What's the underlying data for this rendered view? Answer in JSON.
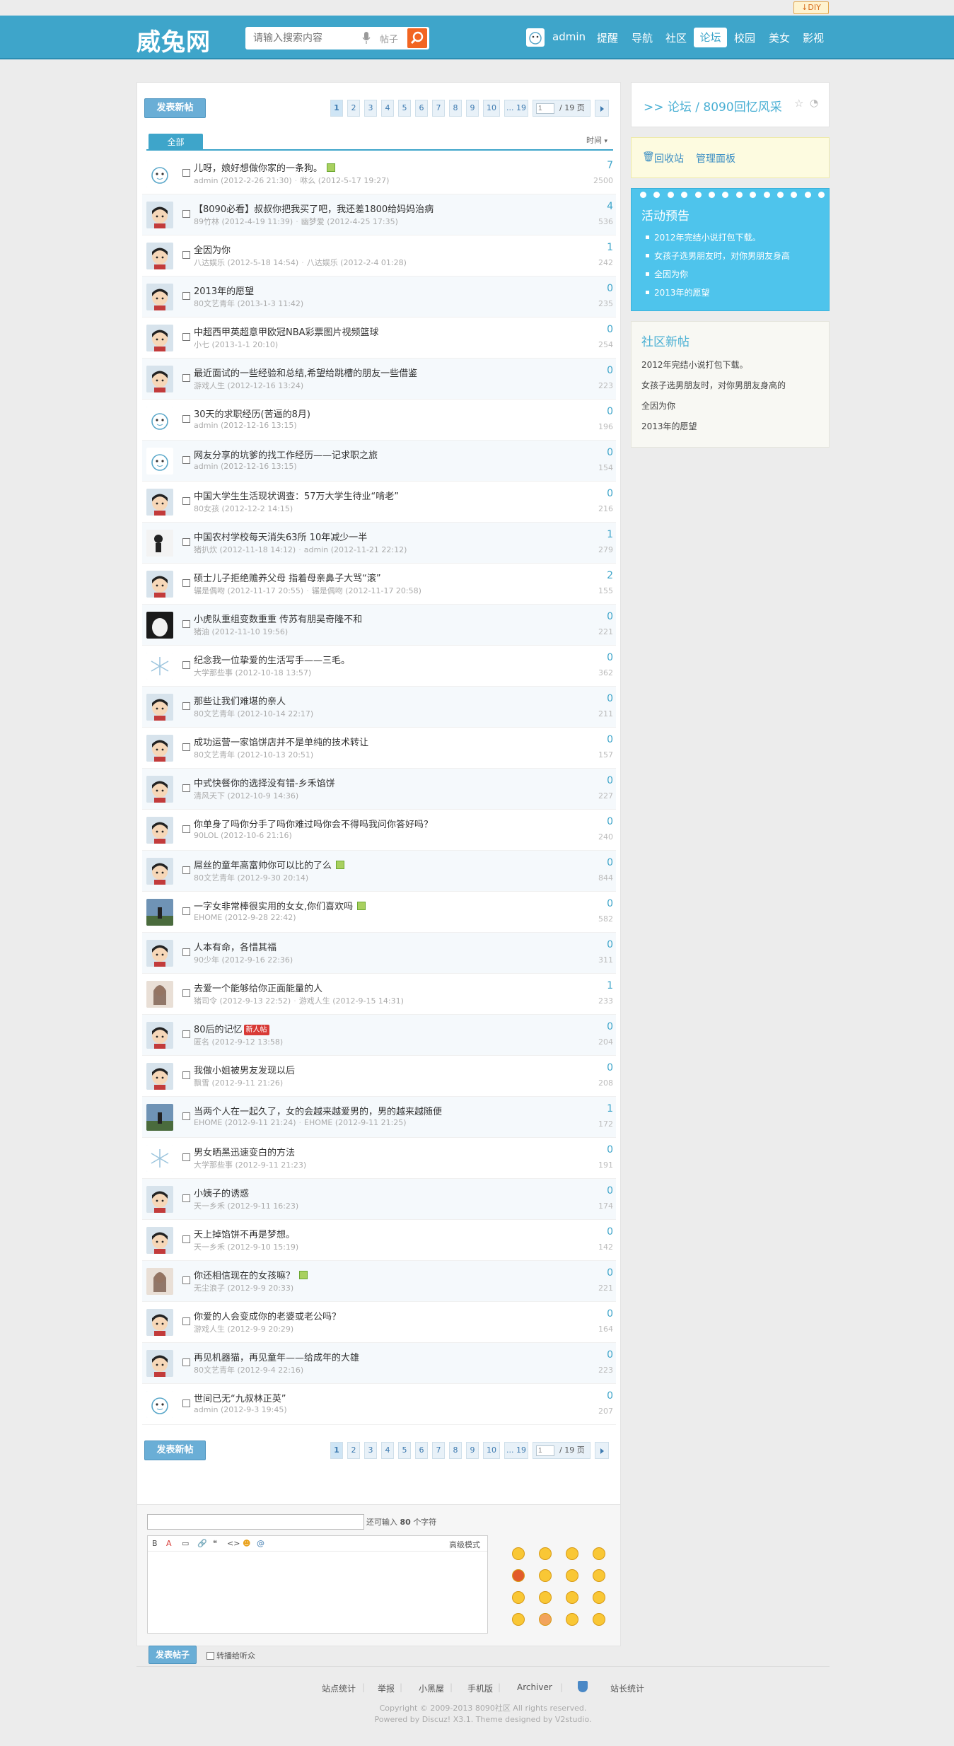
{
  "topbar": {
    "diy": "DIY"
  },
  "header": {
    "logo": "威兔网",
    "search": {
      "placeholder": "请输入搜索内容",
      "type": "帖子"
    },
    "username": "admin",
    "nav": [
      "提醒",
      "导航",
      "社区",
      "论坛",
      "校园",
      "美女",
      "影视"
    ],
    "active_nav": "论坛"
  },
  "toolbar": {
    "new_post": "发表新帖",
    "pages": [
      "1",
      "2",
      "3",
      "4",
      "5",
      "6",
      "7",
      "8",
      "9",
      "10",
      "... 19"
    ],
    "jump_value": "1",
    "jump_total": "/ 19 页"
  },
  "tabs": {
    "all": "全部",
    "sort": "时间"
  },
  "threads": [
    {
      "title": "儿呀，娘好想做你家的一条狗。",
      "author": "admin",
      "date": "(2012-2-26 21:30)",
      "last": "咻么",
      "last_date": "(2012-5-17 19:27)",
      "replies": "7",
      "views": "2500",
      "badge": true
    },
    {
      "title": "【8090必看】叔叔你把我买了吧，我还差1800给妈妈治病",
      "author": "89竹林",
      "date": "(2012-4-19 11:39)",
      "last": "幽梦爱",
      "last_date": "(2012-4-25 17:35)",
      "replies": "4",
      "views": "536",
      "badge": false
    },
    {
      "title": "全因为你",
      "author": "八达娱乐",
      "date": "(2012-5-18 14:54)",
      "last": "八达娱乐",
      "last_date": "(2012-2-4 01:28)",
      "replies": "1",
      "views": "242",
      "badge": false
    },
    {
      "title": "2013年的愿望",
      "author": "80文艺青年",
      "date": "(2013-1-3 11:42)",
      "last": "",
      "last_date": "",
      "replies": "0",
      "views": "235",
      "badge": false
    },
    {
      "title": "中超西甲英超意甲欧冠NBA彩票图片视频篮球",
      "author": "小七",
      "date": "(2013-1-1 20:10)",
      "last": "",
      "last_date": "",
      "replies": "0",
      "views": "254",
      "badge": false
    },
    {
      "title": "最近面试的一些经验和总结,希望给跳槽的朋友一些借鉴",
      "author": "游戏人生",
      "date": "(2012-12-16 13:24)",
      "last": "",
      "last_date": "",
      "replies": "0",
      "views": "223",
      "badge": false
    },
    {
      "title": "30天的求职经历(苦逼的8月)",
      "author": "admin",
      "date": "(2012-12-16 13:15)",
      "last": "",
      "last_date": "",
      "replies": "0",
      "views": "196",
      "badge": false
    },
    {
      "title": "网友分享的坑爹的找工作经历——记求职之旅",
      "author": "admin",
      "date": "(2012-12-16 13:15)",
      "last": "",
      "last_date": "",
      "replies": "0",
      "views": "154",
      "badge": false
    },
    {
      "title": "中国大学生生活现状调查：57万大学生待业“啃老”",
      "author": "80女孩",
      "date": "(2012-12-2 14:15)",
      "last": "",
      "last_date": "",
      "replies": "0",
      "views": "216",
      "badge": false
    },
    {
      "title": "中国农村学校每天消失63所 10年减少一半",
      "author": "猪扒炊",
      "date": "(2012-11-18 14:12)",
      "last": "admin",
      "last_date": "(2012-11-21 22:12)",
      "replies": "1",
      "views": "279",
      "badge": false
    },
    {
      "title": "硕士儿子拒绝赡养父母 指着母亲鼻子大骂“滚”",
      "author": "辗是偶吻",
      "date": "(2012-11-17 20:55)",
      "last": "辗是偶吻",
      "last_date": "(2012-11-17 20:58)",
      "replies": "2",
      "views": "155",
      "badge": false
    },
    {
      "title": "小虎队重组变数重重 传苏有朋吴奇隆不和",
      "author": "猪油",
      "date": "(2012-11-10 19:56)",
      "last": "",
      "last_date": "",
      "replies": "0",
      "views": "221",
      "badge": false
    },
    {
      "title": "纪念我一位挚爱的生活写手——三毛。",
      "author": "大学那些事",
      "date": "(2012-10-18 13:57)",
      "last": "",
      "last_date": "",
      "replies": "0",
      "views": "362",
      "badge": false
    },
    {
      "title": "那些让我们难堪的亲人",
      "author": "80文艺青年",
      "date": "(2012-10-14 22:17)",
      "last": "",
      "last_date": "",
      "replies": "0",
      "views": "211",
      "badge": false
    },
    {
      "title": "成功运营一家馅饼店并不是单纯的技术转让",
      "author": "80文艺青年",
      "date": "(2012-10-13 20:51)",
      "last": "",
      "last_date": "",
      "replies": "0",
      "views": "157",
      "badge": false
    },
    {
      "title": "中式快餐你的选择没有错-乡禾馅饼",
      "author": "清风天下",
      "date": "(2012-10-9 14:36)",
      "last": "",
      "last_date": "",
      "replies": "0",
      "views": "227",
      "badge": false
    },
    {
      "title": "你单身了吗你分手了吗你难过吗你会不得吗我问你答好吗？",
      "author": "90LOL",
      "date": "(2012-10-6 21:16)",
      "last": "",
      "last_date": "",
      "replies": "0",
      "views": "240",
      "badge": false
    },
    {
      "title": "屌丝的童年高富帅你可以比的了么",
      "author": "80文艺青年",
      "date": "(2012-9-30 20:14)",
      "last": "",
      "last_date": "",
      "replies": "0",
      "views": "844",
      "badge": true
    },
    {
      "title": "一字女非常棒很实用的女女,你们喜欢吗",
      "author": "EHOME",
      "date": "(2012-9-28 22:42)",
      "last": "",
      "last_date": "",
      "replies": "0",
      "views": "582",
      "badge": true
    },
    {
      "title": "人本有命，各惜其福",
      "author": "90少年",
      "date": "(2012-9-16 22:36)",
      "last": "",
      "last_date": "",
      "replies": "0",
      "views": "311",
      "badge": false
    },
    {
      "title": "去爱一个能够给你正面能量的人",
      "author": "猪司令",
      "date": "(2012-9-13 22:52)",
      "last": "游戏人生",
      "last_date": "(2012-9-15 14:31)",
      "replies": "1",
      "views": "233",
      "badge": false
    },
    {
      "title": "80后的记忆",
      "author": "匿名",
      "date": "(2012-9-12 13:58)",
      "last": "",
      "last_date": "",
      "replies": "0",
      "views": "204",
      "badge": false,
      "hot": "新人帖"
    },
    {
      "title": "我做小姐被男友发现以后",
      "author": "飘雪",
      "date": "(2012-9-11 21:26)",
      "last": "",
      "last_date": "",
      "replies": "0",
      "views": "208",
      "badge": false
    },
    {
      "title": "当两个人在一起久了，女的会越来越爱男的，男的越来越随便",
      "author": "EHOME",
      "date": "(2012-9-11 21:24)",
      "last": "EHOME",
      "last_date": "(2012-9-11 21:25)",
      "replies": "1",
      "views": "172",
      "badge": false
    },
    {
      "title": "男女晒黑迅速变白的方法",
      "author": "大学那些事",
      "date": "(2012-9-11 21:23)",
      "last": "",
      "last_date": "",
      "replies": "0",
      "views": "191",
      "badge": false
    },
    {
      "title": "小姨子的诱惑",
      "author": "天一乡禾",
      "date": "(2012-9-11 16:23)",
      "last": "",
      "last_date": "",
      "replies": "0",
      "views": "174",
      "badge": false
    },
    {
      "title": "天上掉馅饼不再是梦想。",
      "author": "天一乡禾",
      "date": "(2012-9-10 15:19)",
      "last": "",
      "last_date": "",
      "replies": "0",
      "views": "142",
      "badge": false
    },
    {
      "title": "你还相信现在的女孩嘛？",
      "author": "无尘浪子",
      "date": "(2012-9-9 20:33)",
      "last": "",
      "last_date": "",
      "replies": "0",
      "views": "221",
      "badge": true
    },
    {
      "title": "你爱的人会变成你的老婆或老公吗？",
      "author": "游戏人生",
      "date": "(2012-9-9 20:29)",
      "last": "",
      "last_date": "",
      "replies": "0",
      "views": "164",
      "badge": false
    },
    {
      "title": "再见机器猫，再见童年——给成年的大雄",
      "author": "80文艺青年",
      "date": "(2012-9-4 22:16)",
      "last": "",
      "last_date": "",
      "replies": "0",
      "views": "223",
      "badge": false
    },
    {
      "title": "世间已无“九叔林正英”",
      "author": "admin",
      "date": "(2012-9-3 19:45)",
      "last": "",
      "last_date": "",
      "replies": "0",
      "views": "207",
      "badge": false
    }
  ],
  "reply": {
    "limit_prefix": "还可输入",
    "limit_num": "80",
    "limit_suffix": "个字符",
    "toolbar": [
      "B",
      "A",
      "▭",
      "🔗",
      "❝",
      "<>",
      "☻",
      "@"
    ],
    "advanced": "高级模式",
    "submit": "发表帖子",
    "broadcast": "转播给听众"
  },
  "sidebar": {
    "breadcrumb": ">> 论坛 / 8090回忆风采",
    "admin_links": [
      "回收站",
      "管理面板"
    ],
    "notice_title": "活动预告",
    "notices": [
      "2012年完结小说打包下载。",
      "女孩子选男朋友时，对你男朋友身高",
      "全因为你",
      "2013年的愿望"
    ],
    "newposts_title": "社区新帖",
    "newposts": [
      "2012年完结小说打包下载。",
      "女孩子选男朋友时，对你男朋友身高的",
      "全因为你",
      "2013年的愿望"
    ]
  },
  "footer": {
    "links": [
      "站点统计",
      "举报",
      "小黑屋",
      "手机版",
      "Archiver",
      "站长统计"
    ],
    "copyright": "Copyright © 2009-2013 8090社区 All rights reserved.",
    "powered": "Powered by Discuz! X3.1. Theme designed by V2studio."
  },
  "colors": {
    "brand": "#3ea5ca",
    "accent": "#f26522",
    "notice": "#4ec4ec"
  }
}
